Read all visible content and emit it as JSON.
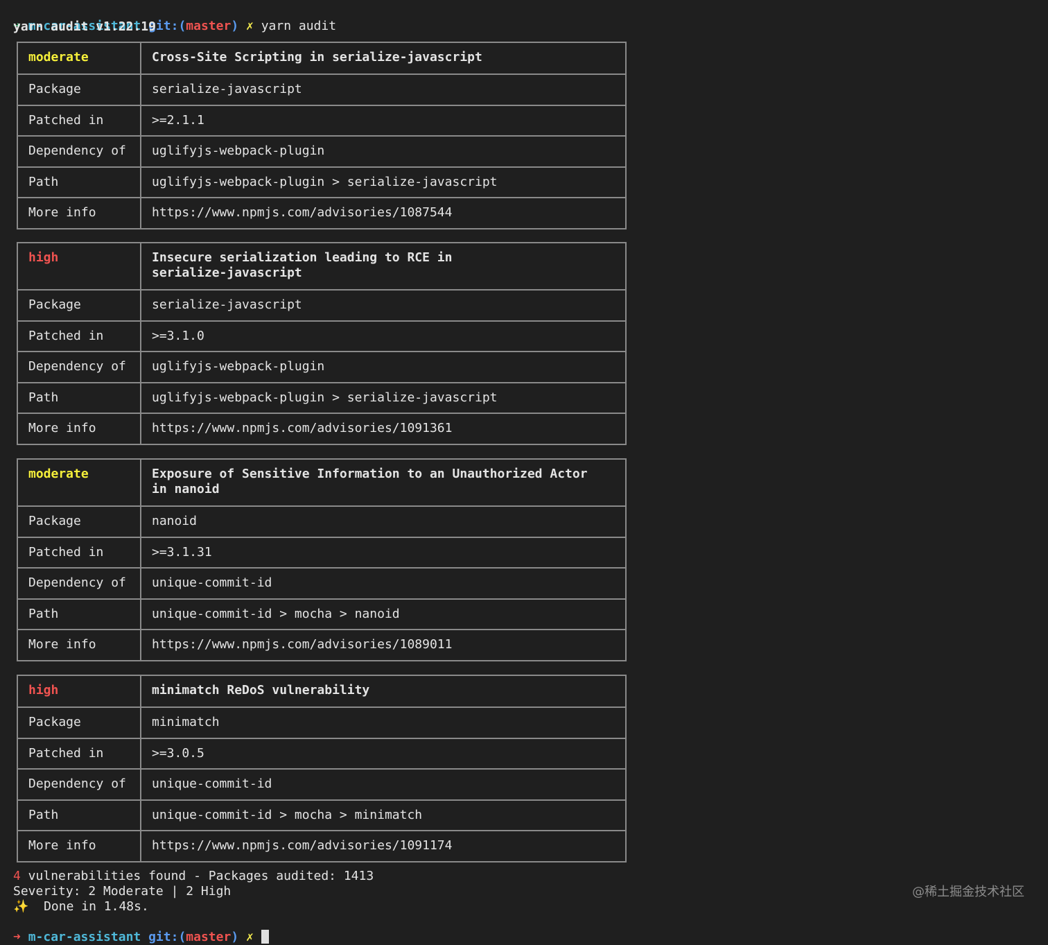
{
  "prompt_top": {
    "arrow": "➜",
    "dir": "m-car-assistant",
    "git_prefix": "git:(",
    "branch": "master",
    "git_suffix": ")",
    "dirty": "✗",
    "command": "yarn audit"
  },
  "version_line": "yarn audit v1.22.19",
  "advisories": [
    {
      "severity": "moderate",
      "title": "Cross-Site Scripting in serialize-javascript",
      "rows": [
        {
          "label": "Package",
          "value": "serialize-javascript"
        },
        {
          "label": "Patched in",
          "value": ">=2.1.1"
        },
        {
          "label": "Dependency of",
          "value": "uglifyjs-webpack-plugin"
        },
        {
          "label": "Path",
          "value": "uglifyjs-webpack-plugin > serialize-javascript"
        },
        {
          "label": "More info",
          "value": "https://www.npmjs.com/advisories/1087544"
        }
      ]
    },
    {
      "severity": "high",
      "title": "Insecure serialization leading to RCE in\nserialize-javascript",
      "rows": [
        {
          "label": "Package",
          "value": "serialize-javascript"
        },
        {
          "label": "Patched in",
          "value": ">=3.1.0"
        },
        {
          "label": "Dependency of",
          "value": "uglifyjs-webpack-plugin"
        },
        {
          "label": "Path",
          "value": "uglifyjs-webpack-plugin > serialize-javascript"
        },
        {
          "label": "More info",
          "value": "https://www.npmjs.com/advisories/1091361"
        }
      ]
    },
    {
      "severity": "moderate",
      "title": "Exposure of Sensitive Information to an Unauthorized Actor\nin nanoid",
      "rows": [
        {
          "label": "Package",
          "value": "nanoid"
        },
        {
          "label": "Patched in",
          "value": ">=3.1.31"
        },
        {
          "label": "Dependency of",
          "value": "unique-commit-id"
        },
        {
          "label": "Path",
          "value": "unique-commit-id > mocha > nanoid"
        },
        {
          "label": "More info",
          "value": "https://www.npmjs.com/advisories/1089011"
        }
      ]
    },
    {
      "severity": "high",
      "title": "minimatch ReDoS vulnerability",
      "rows": [
        {
          "label": "Package",
          "value": "minimatch"
        },
        {
          "label": "Patched in",
          "value": ">=3.0.5"
        },
        {
          "label": "Dependency of",
          "value": "unique-commit-id"
        },
        {
          "label": "Path",
          "value": "unique-commit-id > mocha > minimatch"
        },
        {
          "label": "More info",
          "value": "https://www.npmjs.com/advisories/1091174"
        }
      ]
    }
  ],
  "summary": {
    "count": "4",
    "found_text": " vulnerabilities found - Packages audited: 1413",
    "severity_line": "Severity: 2 Moderate | 2 High",
    "sparkle": "✨",
    "done_text": "  Done in 1.48s."
  },
  "prompt_bottom": {
    "arrow": "➜",
    "dir": "m-car-assistant",
    "git_prefix": "git:(",
    "branch": "master",
    "git_suffix": ")",
    "dirty": "✗"
  },
  "watermark": "@稀土掘金技术社区",
  "colors": {
    "background": "#1f1f1f",
    "moderate": "#f5ef3a",
    "high": "#ef5350",
    "border": "#8a8a8a"
  }
}
